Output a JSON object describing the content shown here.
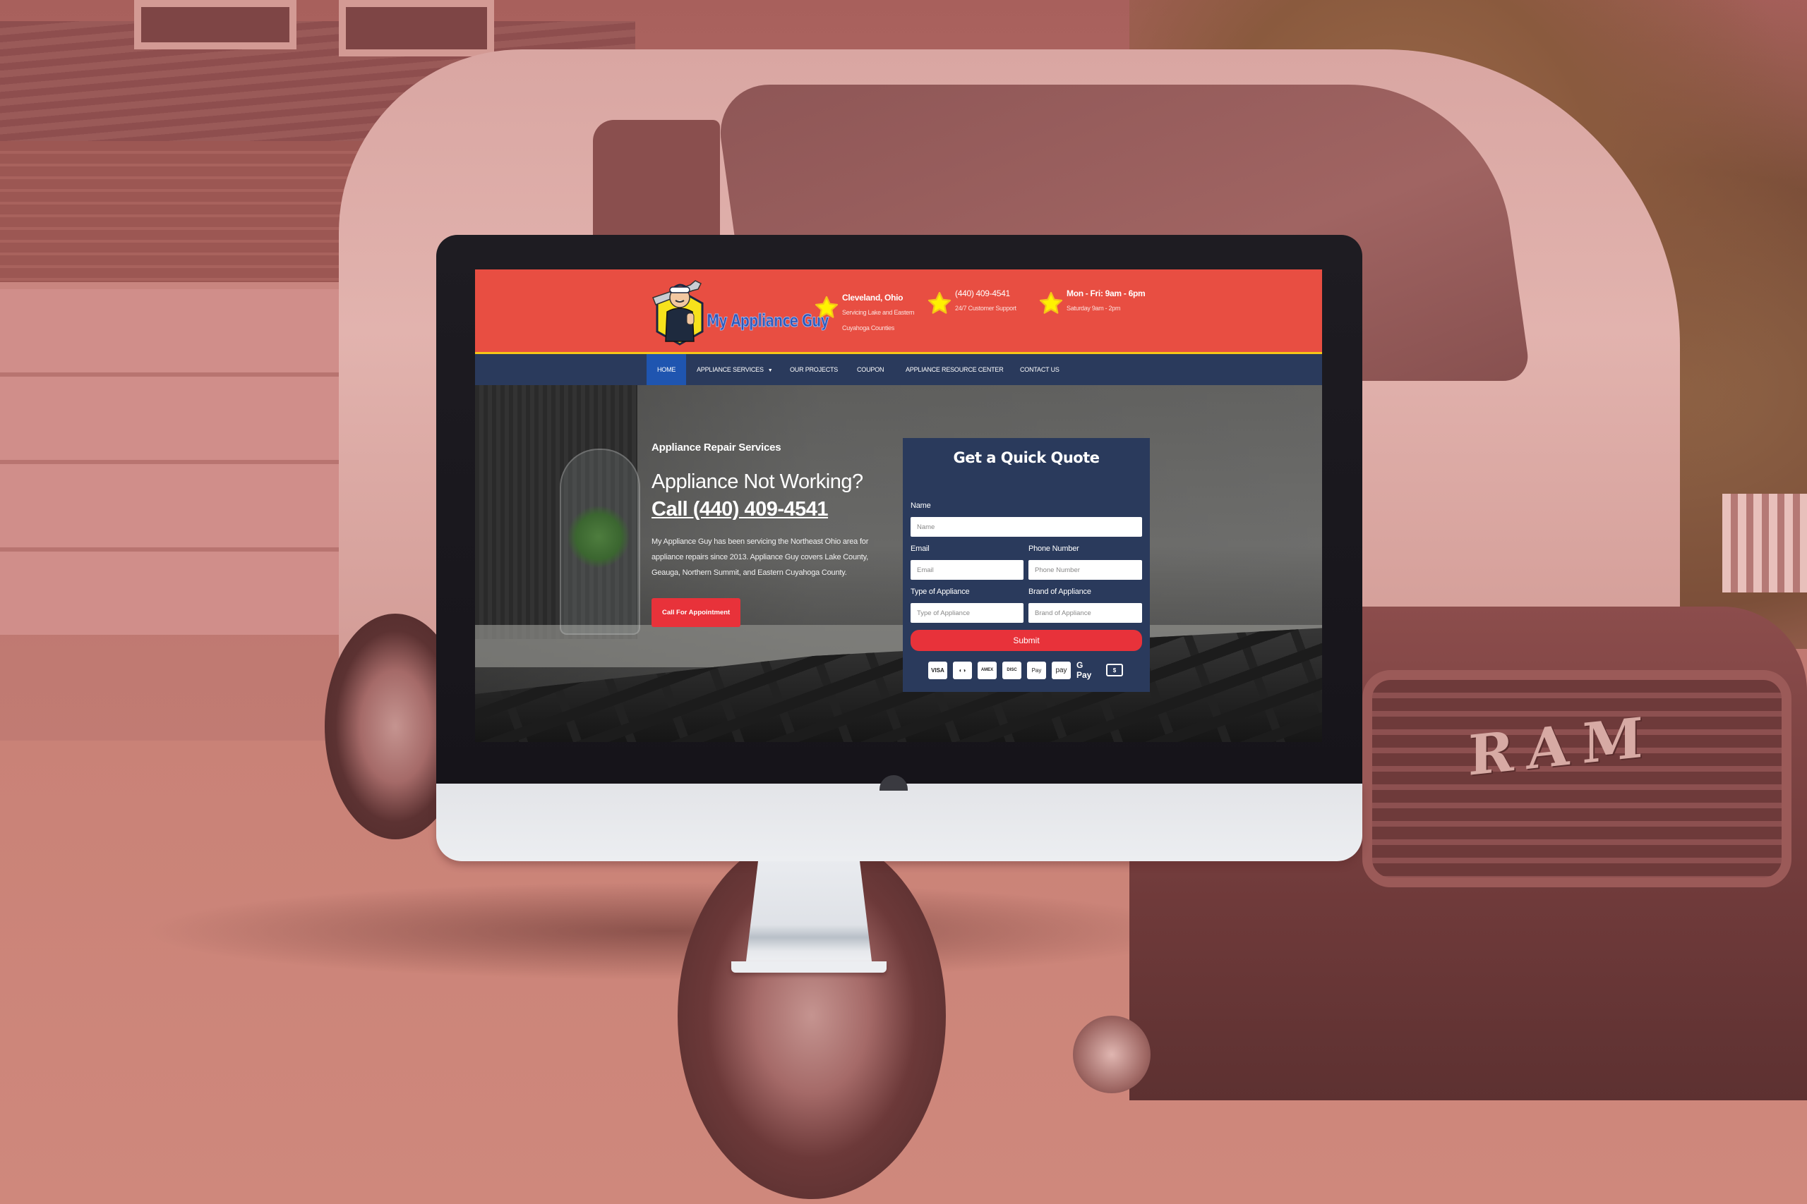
{
  "site": {
    "brand_name": "My Appliance Guy",
    "colors": {
      "header_red": "#e84e42",
      "nav_navy": "#2a3a5c",
      "nav_active": "#1f55b0",
      "accent_yellow": "#f5c518",
      "button_red": "#e8323a",
      "overlay_tint": "#b65d5a"
    },
    "header": {
      "info_blocks": [
        {
          "icon": "star-icon",
          "title": "Cleveland, Ohio",
          "line1": "Servicing Lake and Eastern",
          "line2": "Cuyahoga Counties"
        },
        {
          "icon": "star-icon",
          "title": "(440) 409-4541",
          "line1": "24/7 Customer Support"
        },
        {
          "icon": "star-icon",
          "title": "Mon - Fri: 9am - 6pm",
          "line1": "Saturday 9am - 2pm"
        }
      ]
    },
    "nav": {
      "items": [
        {
          "label": "HOME",
          "active": true
        },
        {
          "label": "APPLIANCE SERVICES",
          "has_dropdown": true,
          "caret": "▼"
        },
        {
          "label": "OUR PROJECTS"
        },
        {
          "label": "COUPON"
        },
        {
          "label": "APPLIANCE RESOURCE CENTER"
        },
        {
          "label": "CONTACT US"
        }
      ]
    },
    "hero": {
      "eyebrow": "Appliance Repair Services",
      "headline": "Appliance Not Working?",
      "call_link": "Call (440) 409-4541",
      "description": "My Appliance Guy has been servicing the Northeast Ohio area for appliance repairs since 2013. Appliance Guy covers Lake County, Geauga, Northern Summit, and Eastern Cuyahoga County.",
      "cta_label": "Call For Appointment"
    },
    "quote_form": {
      "title": "Get a Quick Quote",
      "fields": {
        "name": {
          "label": "Name",
          "placeholder": "Name",
          "value": ""
        },
        "email": {
          "label": "Email",
          "placeholder": "Email",
          "value": ""
        },
        "phone": {
          "label": "Phone Number",
          "placeholder": "Phone Number",
          "value": ""
        },
        "type": {
          "label": "Type of Appliance",
          "placeholder": "Type of Appliance",
          "value": ""
        },
        "brand": {
          "label": "Brand of Appliance",
          "placeholder": "Brand of Appliance",
          "value": ""
        }
      },
      "submit_label": "Submit",
      "payment_methods": [
        {
          "name": "visa",
          "label": "VISA"
        },
        {
          "name": "mastercard",
          "label": "◐◑"
        },
        {
          "name": "american-express",
          "label": "AMEX"
        },
        {
          "name": "discover",
          "label": "DISC"
        },
        {
          "name": "apple-pay",
          "label": "Pay"
        },
        {
          "name": "amazon-pay",
          "label": "pay"
        },
        {
          "name": "google-pay",
          "label": "G Pay"
        },
        {
          "name": "cash",
          "label": "$"
        }
      ]
    }
  },
  "background": {
    "vehicle_badge": "RAM"
  }
}
